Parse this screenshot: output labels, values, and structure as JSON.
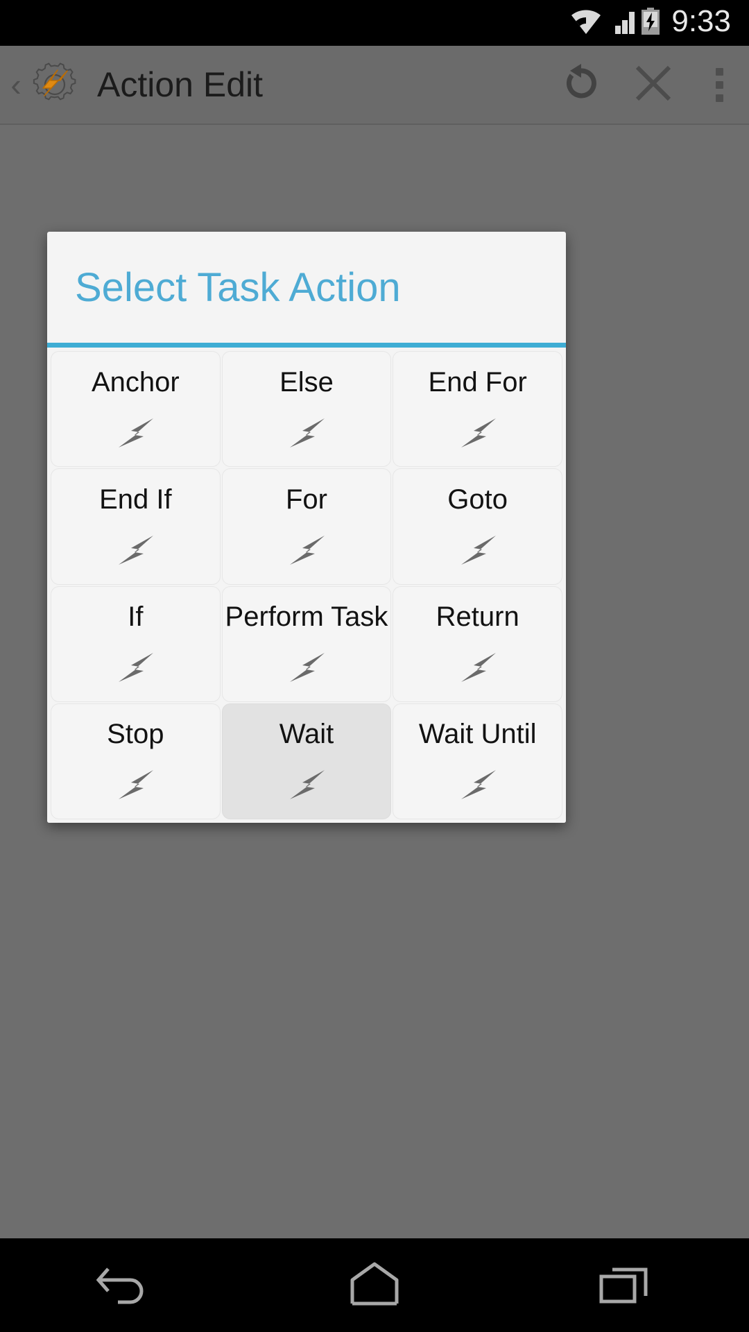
{
  "status_bar": {
    "time": "9:33",
    "icons": [
      "wifi-icon",
      "cellular-signal-icon",
      "battery-charging-icon"
    ]
  },
  "action_bar": {
    "back_chevron": "‹",
    "app_icon": "tasker-gear-bolt-icon",
    "title": "Action Edit",
    "buttons": [
      {
        "name": "undo-button",
        "icon": "undo-rotate-left-icon"
      },
      {
        "name": "close-button",
        "icon": "close-x-icon"
      },
      {
        "name": "overflow-menu-button",
        "icon": "overflow-dots-icon"
      }
    ]
  },
  "dialog": {
    "title": "Select Task Action",
    "accent_color": "#3fadd4",
    "title_color": "#4eabd4",
    "background_color": "#f4f4f4",
    "selected_cell_color": "#e2e2e2",
    "items": [
      {
        "label": "Anchor",
        "icon": "lightning-bolt-icon",
        "selected": false
      },
      {
        "label": "Else",
        "icon": "lightning-bolt-icon",
        "selected": false
      },
      {
        "label": "End For",
        "icon": "lightning-bolt-icon",
        "selected": false
      },
      {
        "label": "End If",
        "icon": "lightning-bolt-icon",
        "selected": false
      },
      {
        "label": "For",
        "icon": "lightning-bolt-icon",
        "selected": false
      },
      {
        "label": "Goto",
        "icon": "lightning-bolt-icon",
        "selected": false
      },
      {
        "label": "If",
        "icon": "lightning-bolt-icon",
        "selected": false
      },
      {
        "label": "Perform Task",
        "icon": "lightning-bolt-icon",
        "selected": false
      },
      {
        "label": "Return",
        "icon": "lightning-bolt-icon",
        "selected": false
      },
      {
        "label": "Stop",
        "icon": "lightning-bolt-icon",
        "selected": false
      },
      {
        "label": "Wait",
        "icon": "lightning-bolt-icon",
        "selected": true
      },
      {
        "label": "Wait Until",
        "icon": "lightning-bolt-icon",
        "selected": false
      }
    ]
  },
  "nav_bar": {
    "buttons": [
      {
        "name": "nav-back-button",
        "icon": "back-arrow-icon"
      },
      {
        "name": "nav-home-button",
        "icon": "home-icon"
      },
      {
        "name": "nav-recents-button",
        "icon": "recents-icon"
      }
    ]
  }
}
